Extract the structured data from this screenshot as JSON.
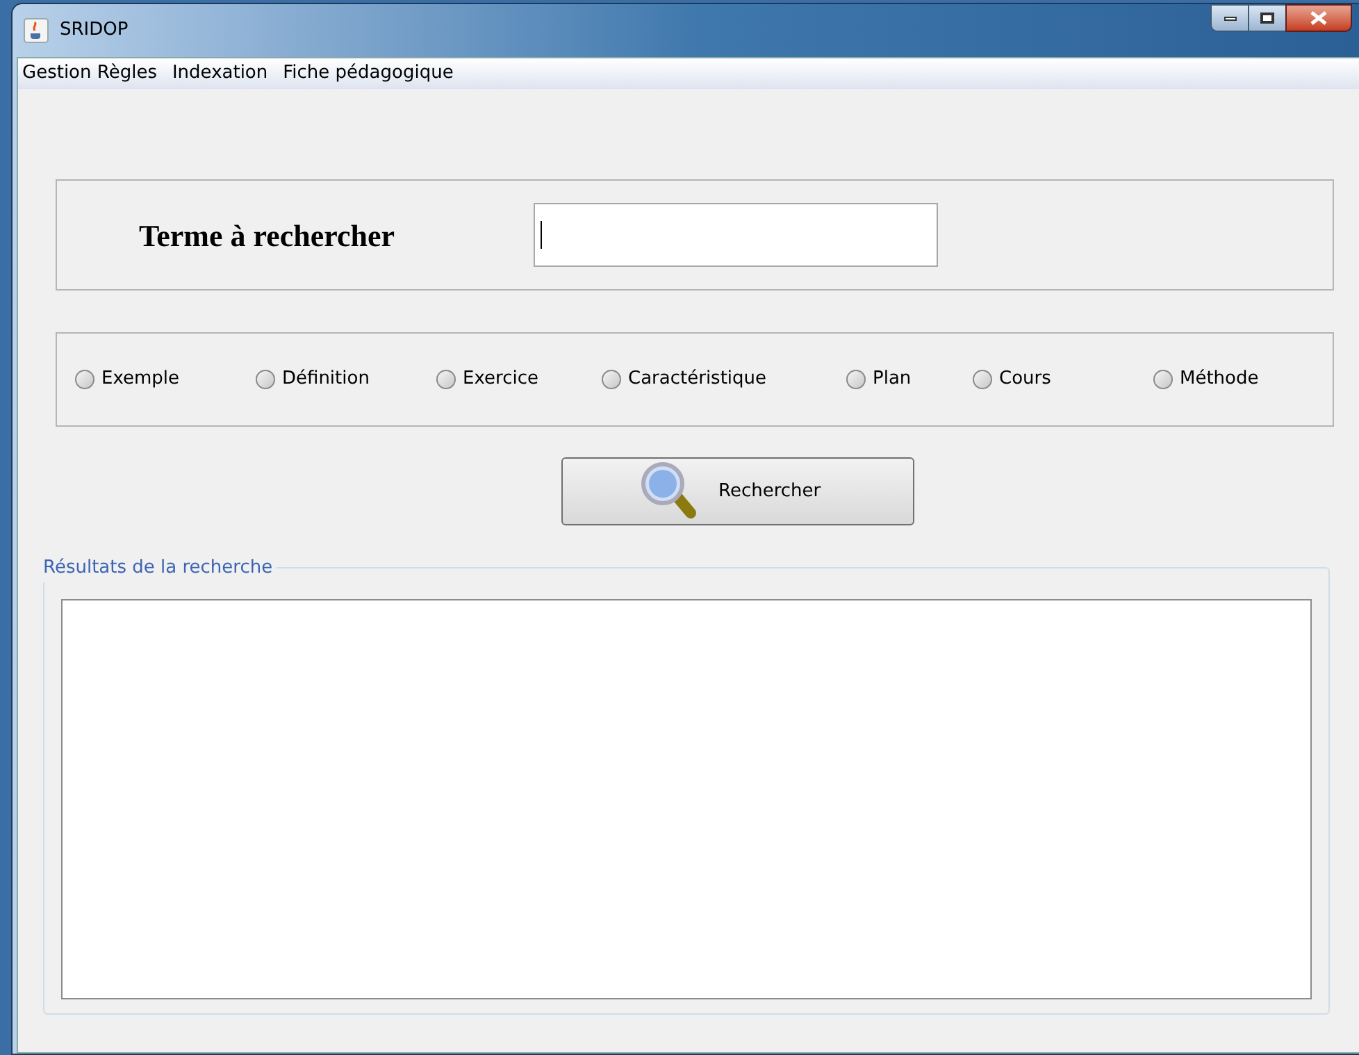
{
  "window": {
    "title": "SRIDOP"
  },
  "menu": [
    {
      "label": "Gestion Règles"
    },
    {
      "label": "Indexation"
    },
    {
      "label": "Fiche pédagogique"
    }
  ],
  "search": {
    "label": "Terme à rechercher",
    "focused": true
  },
  "categories": [
    {
      "label": "Exemple",
      "selected": false
    },
    {
      "label": "Définition",
      "selected": false
    },
    {
      "label": "Exercice",
      "selected": false
    },
    {
      "label": "Caractéristique",
      "selected": false
    },
    {
      "label": "Plan",
      "selected": false
    },
    {
      "label": "Cours",
      "selected": false
    },
    {
      "label": "Méthode",
      "selected": false
    }
  ],
  "search_button": {
    "label": "Rechercher"
  },
  "results": {
    "title": "Résultats de la recherche"
  }
}
